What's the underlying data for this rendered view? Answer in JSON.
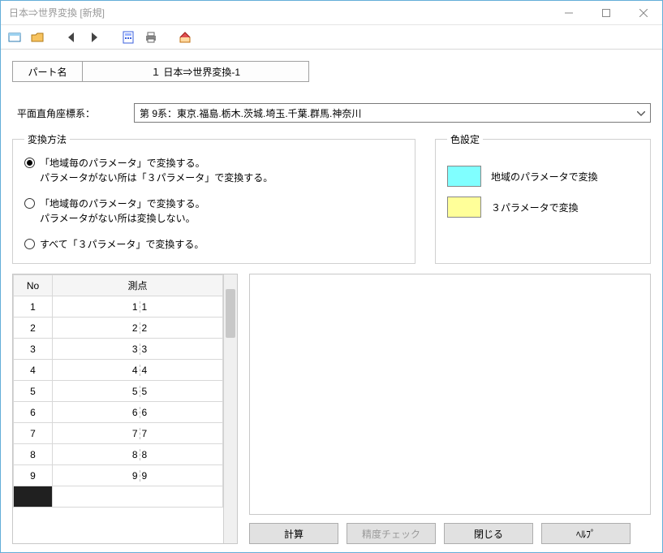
{
  "window_title": "日本⇒世界変換 [新規]",
  "tabs": {
    "header": "パート名",
    "value": "１ 日本⇒世界変換-1"
  },
  "coord_label": "平面直角座標系：",
  "coord_value": "第 9系：東京.福島.栃木.茨城.埼玉.千葉.群馬.神奈川",
  "method": {
    "legend": "変換方法",
    "opt1_line1": "「地域毎のパラメータ」で変換する。",
    "opt1_line2": "パラメータがない所は「３パラメータ」で変換する。",
    "opt2_line1": "「地域毎のパラメータ」で変換する。",
    "opt2_line2": "パラメータがない所は変換しない。",
    "opt3": "すべて「３パラメータ」で変換する。"
  },
  "colors": {
    "legend": "色設定",
    "c1_label": "地域のパラメータで変換",
    "c1_hex": "#80ffff",
    "c2_label": "３パラメータで変換",
    "c2_hex": "#ffff99"
  },
  "grid": {
    "head_no": "No",
    "head_pt": "測点",
    "rows": [
      {
        "no": "1",
        "dec": "1",
        "frac": "1"
      },
      {
        "no": "2",
        "dec": "2",
        "frac": "2"
      },
      {
        "no": "3",
        "dec": "3",
        "frac": "3"
      },
      {
        "no": "4",
        "dec": "4",
        "frac": "4"
      },
      {
        "no": "5",
        "dec": "5",
        "frac": "5"
      },
      {
        "no": "6",
        "dec": "6",
        "frac": "6"
      },
      {
        "no": "7",
        "dec": "7",
        "frac": "7"
      },
      {
        "no": "8",
        "dec": "8",
        "frac": "8"
      },
      {
        "no": "9",
        "dec": "9",
        "frac": "9"
      }
    ]
  },
  "buttons": {
    "calc": "計算",
    "accuracy": "精度チェック",
    "close": "閉じる",
    "help": "ﾍﾙﾌﾟ"
  }
}
